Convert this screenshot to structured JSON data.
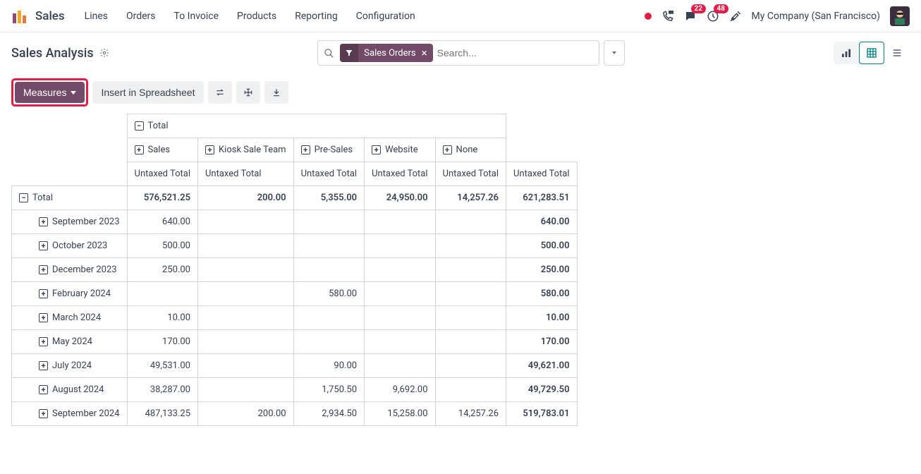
{
  "app": {
    "name": "Sales"
  },
  "nav": {
    "items": [
      "Lines",
      "Orders",
      "To Invoice",
      "Products",
      "Reporting",
      "Configuration"
    ]
  },
  "topright": {
    "messages_badge": "22",
    "activities_badge": "48",
    "company": "My Company (San Francisco)"
  },
  "page": {
    "title": "Sales Analysis"
  },
  "search": {
    "chip_label": "Sales Orders",
    "placeholder": "Search..."
  },
  "toolbar": {
    "measures": "Measures",
    "insert": "Insert in Spreadsheet"
  },
  "pivot": {
    "total_label": "Total",
    "measure_label": "Untaxed Total",
    "col_groups": [
      "Sales",
      "Kiosk Sale Team",
      "Pre-Sales",
      "Website",
      "None"
    ],
    "rows": [
      {
        "label": "Total",
        "expandable": false,
        "expanded": true,
        "indent": false,
        "cells": [
          "576,521.25",
          "200.00",
          "5,355.00",
          "24,950.00",
          "14,257.26",
          "621,283.51"
        ],
        "bold": true
      },
      {
        "label": "September 2023",
        "expandable": true,
        "indent": true,
        "cells": [
          "640.00",
          "",
          "",
          "",
          "",
          "640.00"
        ]
      },
      {
        "label": "October 2023",
        "expandable": true,
        "indent": true,
        "cells": [
          "500.00",
          "",
          "",
          "",
          "",
          "500.00"
        ]
      },
      {
        "label": "December 2023",
        "expandable": true,
        "indent": true,
        "cells": [
          "250.00",
          "",
          "",
          "",
          "",
          "250.00"
        ]
      },
      {
        "label": "February 2024",
        "expandable": true,
        "indent": true,
        "cells": [
          "",
          "",
          "580.00",
          "",
          "",
          "580.00"
        ]
      },
      {
        "label": "March 2024",
        "expandable": true,
        "indent": true,
        "cells": [
          "10.00",
          "",
          "",
          "",
          "",
          "10.00"
        ]
      },
      {
        "label": "May 2024",
        "expandable": true,
        "indent": true,
        "cells": [
          "170.00",
          "",
          "",
          "",
          "",
          "170.00"
        ]
      },
      {
        "label": "July 2024",
        "expandable": true,
        "indent": true,
        "cells": [
          "49,531.00",
          "",
          "90.00",
          "",
          "",
          "49,621.00"
        ]
      },
      {
        "label": "August 2024",
        "expandable": true,
        "indent": true,
        "cells": [
          "38,287.00",
          "",
          "1,750.50",
          "9,692.00",
          "",
          "49,729.50"
        ]
      },
      {
        "label": "September 2024",
        "expandable": true,
        "indent": true,
        "cells": [
          "487,133.25",
          "200.00",
          "2,934.50",
          "15,258.00",
          "14,257.26",
          "519,783.01"
        ]
      }
    ]
  }
}
